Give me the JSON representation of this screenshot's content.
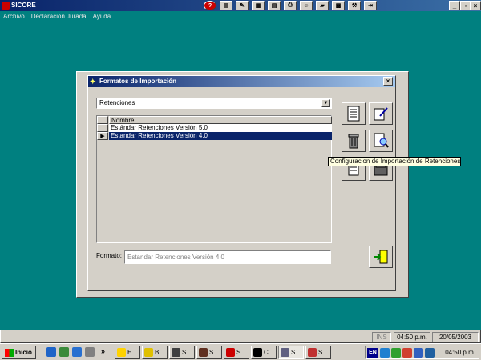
{
  "app": {
    "title": "SICORE",
    "menu": [
      "Archivo",
      "Declaración Jurada",
      "Ayuda"
    ],
    "window_controls": {
      "minimize": "_",
      "restore": "▫",
      "close": "×"
    }
  },
  "dialog": {
    "title": "Formatos de Importación",
    "close_label": "×",
    "type_select": {
      "value": "Retenciones"
    },
    "grid": {
      "header": "Nombre",
      "rows": [
        {
          "name": "Estándar Retenciones Versión 5.0",
          "selected": false
        },
        {
          "name": "Estandar Retenciones Versión 4.0",
          "selected": true
        }
      ]
    },
    "format_label": "Formato:",
    "format_value": "Estandar Retenciones Versión 4.0",
    "tooltip": "Configuracion de Importación de Retenciones"
  },
  "statusbar": {
    "ins": "INS",
    "time": "04:50 p.m.",
    "date": "20/05/2003"
  },
  "taskbar": {
    "start_label": "Inicio",
    "more_label": "»",
    "tasks": [
      "E...",
      "B...",
      "S...",
      "S...",
      "S...",
      "C...",
      "S...",
      "S..."
    ],
    "lang": "EN",
    "clock": "04:50 p.m."
  },
  "colors": {
    "desktop": "#008080",
    "title_active": "#0a246a",
    "face": "#d4d0c8",
    "selection": "#0a246a",
    "tooltip": "#ffffe1"
  }
}
